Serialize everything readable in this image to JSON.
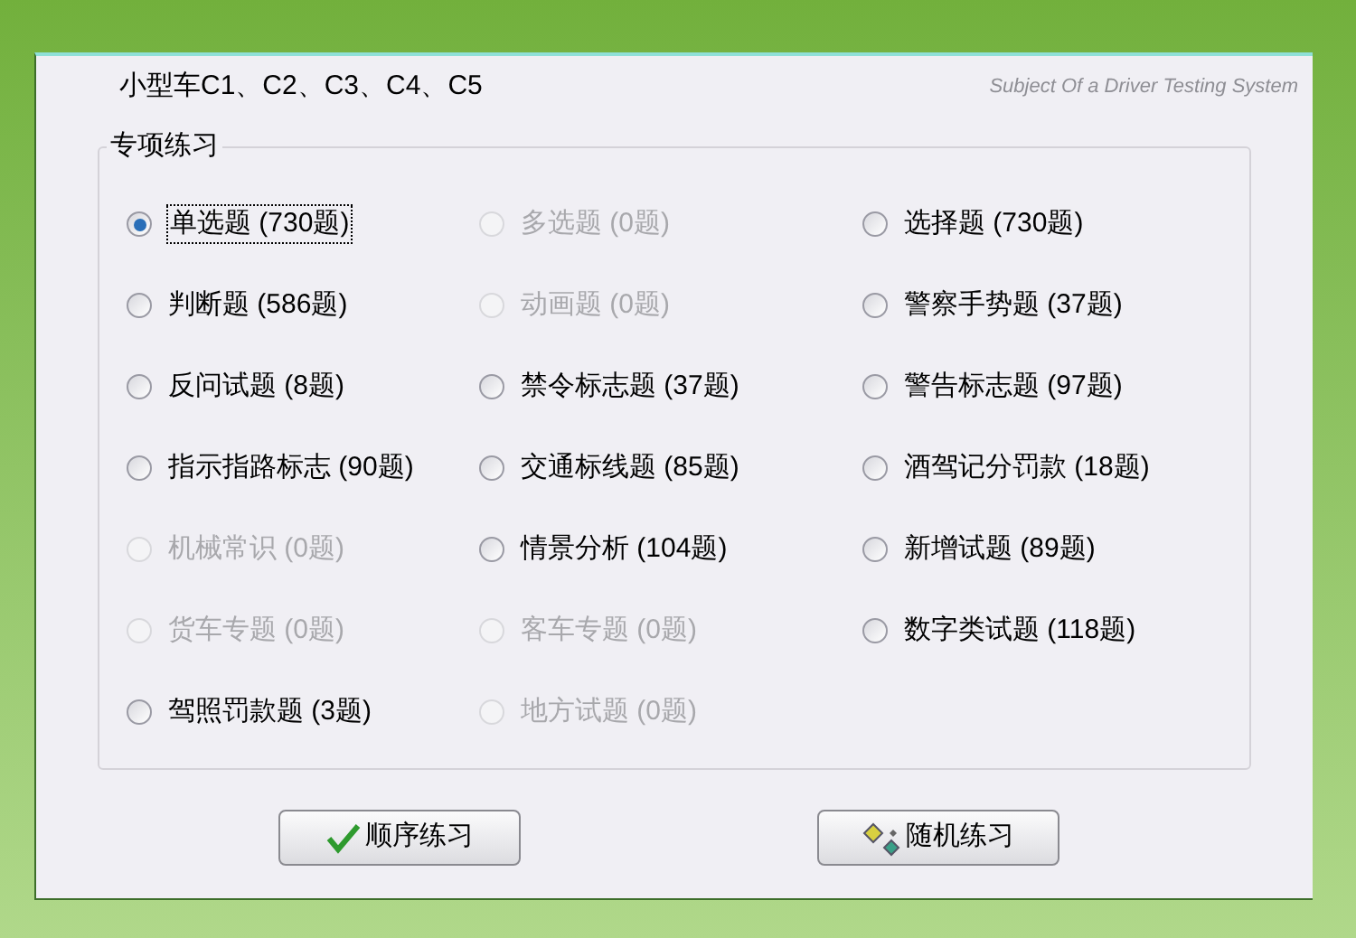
{
  "header": {
    "title": "小型车C1、C2、C3、C4、C5",
    "subtitle": "Subject Of a Driver Testing System"
  },
  "group": {
    "title": "专项练习",
    "options": [
      {
        "label": "单选题 (730题)",
        "selected": true,
        "disabled": false
      },
      {
        "label": "多选题 (0题)",
        "selected": false,
        "disabled": true
      },
      {
        "label": "选择题 (730题)",
        "selected": false,
        "disabled": false
      },
      {
        "label": "判断题 (586题)",
        "selected": false,
        "disabled": false
      },
      {
        "label": "动画题 (0题)",
        "selected": false,
        "disabled": true
      },
      {
        "label": "警察手势题 (37题)",
        "selected": false,
        "disabled": false
      },
      {
        "label": "反问试题 (8题)",
        "selected": false,
        "disabled": false
      },
      {
        "label": "禁令标志题 (37题)",
        "selected": false,
        "disabled": false
      },
      {
        "label": "警告标志题 (97题)",
        "selected": false,
        "disabled": false
      },
      {
        "label": "指示指路标志 (90题)",
        "selected": false,
        "disabled": false
      },
      {
        "label": "交通标线题 (85题)",
        "selected": false,
        "disabled": false
      },
      {
        "label": "酒驾记分罚款 (18题)",
        "selected": false,
        "disabled": false
      },
      {
        "label": "机械常识 (0题)",
        "selected": false,
        "disabled": true
      },
      {
        "label": "情景分析 (104题)",
        "selected": false,
        "disabled": false
      },
      {
        "label": "新增试题 (89题)",
        "selected": false,
        "disabled": false
      },
      {
        "label": "货车专题 (0题)",
        "selected": false,
        "disabled": true
      },
      {
        "label": "客车专题 (0题)",
        "selected": false,
        "disabled": true
      },
      {
        "label": "数字类试题 (118题)",
        "selected": false,
        "disabled": false
      },
      {
        "label": "驾照罚款题 (3题)",
        "selected": false,
        "disabled": false
      },
      {
        "label": "地方试题 (0题)",
        "selected": false,
        "disabled": true
      }
    ]
  },
  "buttons": [
    {
      "kind": "sequential",
      "label": "顺序练习"
    },
    {
      "kind": "random",
      "label": "随机练习"
    }
  ]
}
